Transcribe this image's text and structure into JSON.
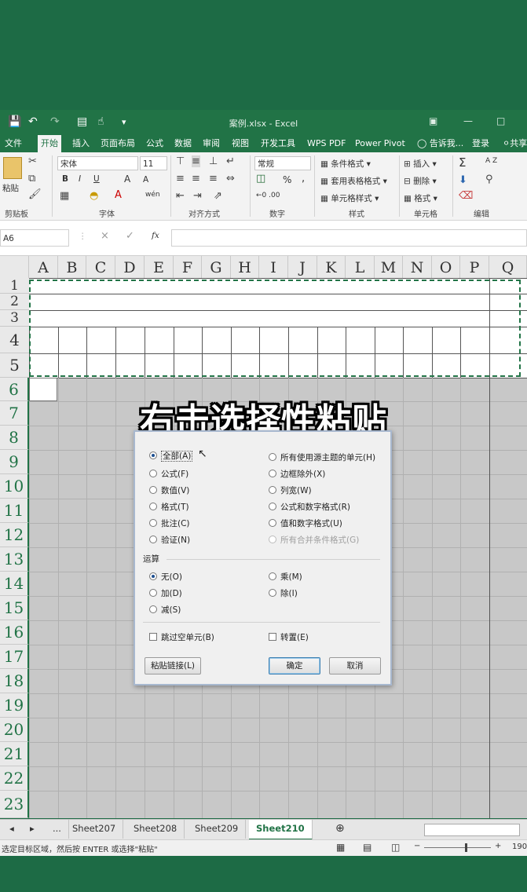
{
  "window": {
    "title": "案例.xlsx - Excel",
    "quick_access": [
      "save-icon",
      "undo-icon",
      "redo-icon",
      "form-icon",
      "touch-mode-icon"
    ]
  },
  "ribbon_tabs": [
    "文件",
    "开始",
    "插入",
    "页面布局",
    "公式",
    "数据",
    "审阅",
    "视图",
    "开发工具",
    "WPS PDF",
    "Power Pivot",
    "告诉我...",
    "登录",
    "共享"
  ],
  "active_tab": "开始",
  "ribbon": {
    "clipboard": {
      "paste": "粘贴",
      "label": "剪贴板"
    },
    "font": {
      "name": "宋体",
      "size": "11",
      "bold": "B",
      "italic": "I",
      "underline": "U",
      "grow": "A",
      "shrink": "A",
      "phonetic": "wén",
      "label": "字体"
    },
    "alignment": {
      "label": "对齐方式"
    },
    "number": {
      "format": "常规",
      "percent": "%",
      "comma": ",",
      "inc_dec": "←0 .00",
      "label": "数字"
    },
    "styles": {
      "conditional": "条件格式",
      "table": "套用表格格式",
      "cell": "单元格样式",
      "label": "样式"
    },
    "cells": {
      "insert": "插入",
      "delete": "删除",
      "format": "格式",
      "label": "单元格"
    },
    "editing": {
      "sum": "Σ",
      "sort": "A Z",
      "label": "编辑"
    }
  },
  "formula_bar": {
    "name_box": "A6",
    "cancel": "×",
    "enter": "✓",
    "fx": "fx",
    "value": ""
  },
  "columns": [
    "A",
    "B",
    "C",
    "D",
    "E",
    "F",
    "G",
    "H",
    "I",
    "J",
    "K",
    "L",
    "M",
    "N",
    "O",
    "P",
    "Q"
  ],
  "rows": [
    "1",
    "2",
    "3",
    "4",
    "5",
    "6",
    "7",
    "8",
    "9",
    "10",
    "11",
    "12",
    "13",
    "14",
    "15",
    "16",
    "17",
    "18",
    "19",
    "20",
    "21",
    "22",
    "23"
  ],
  "selected_cell": "A6",
  "caption": "右击选择性粘贴",
  "dialog": {
    "paste_options_left": [
      {
        "label": "全部(A)",
        "checked": true
      },
      {
        "label": "公式(F)",
        "checked": false
      },
      {
        "label": "数值(V)",
        "checked": false
      },
      {
        "label": "格式(T)",
        "checked": false
      },
      {
        "label": "批注(C)",
        "checked": false
      },
      {
        "label": "验证(N)",
        "checked": false
      }
    ],
    "paste_options_right": [
      {
        "label": "所有使用源主题的单元(H)",
        "disabled": false
      },
      {
        "label": "边框除外(X)",
        "disabled": false
      },
      {
        "label": "列宽(W)",
        "disabled": false
      },
      {
        "label": "公式和数字格式(R)",
        "disabled": false
      },
      {
        "label": "值和数字格式(U)",
        "disabled": false
      },
      {
        "label": "所有合并条件格式(G)",
        "disabled": true
      }
    ],
    "operation_label": "运算",
    "operation_left": [
      {
        "label": "无(O)",
        "checked": true
      },
      {
        "label": "加(D)",
        "checked": false
      },
      {
        "label": "减(S)",
        "checked": false
      }
    ],
    "operation_right": [
      {
        "label": "乘(M)",
        "checked": false
      },
      {
        "label": "除(I)",
        "checked": false
      }
    ],
    "skip_blanks": "跳过空单元(B)",
    "transpose": "转置(E)",
    "paste_link": "粘贴链接(L)",
    "ok": "确定",
    "cancel": "取消"
  },
  "sheet_tabs": [
    "Sheet207",
    "Sheet208",
    "Sheet209",
    "Sheet210"
  ],
  "active_sheet": "Sheet210",
  "sheet_nav": {
    "prev": "◂",
    "next": "▸",
    "more": "...",
    "add": "⊕"
  },
  "status": {
    "message": "选定目标区域，然后按 ENTER 或选择\"粘贴\"",
    "zoom": "190"
  },
  "colors": {
    "excel_green": "#217346",
    "ribbon_bg": "#f3f3f3",
    "copy_marquee": "#217346"
  }
}
